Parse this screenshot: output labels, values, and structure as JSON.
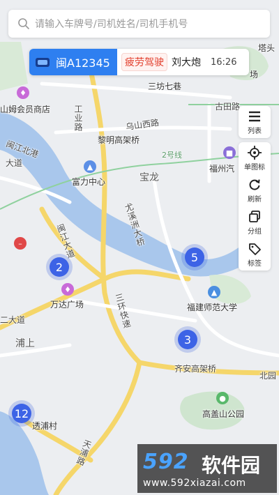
{
  "search": {
    "placeholder": "请输入车牌号/司机姓名/司机手机号"
  },
  "vehicle_card": {
    "plate": "闽A12345",
    "status": "疲劳驾驶",
    "driver": "刘大炮",
    "time": "16:26"
  },
  "toolbar_top": [
    {
      "label": "列表",
      "icon": "list-icon"
    }
  ],
  "toolbar_main": [
    {
      "label": "单图标",
      "icon": "crosshair-icon"
    },
    {
      "label": "刷新",
      "icon": "refresh-icon"
    },
    {
      "label": "分组",
      "icon": "group-icon"
    },
    {
      "label": "标签",
      "icon": "tag-icon"
    }
  ],
  "clusters": [
    {
      "count": "2"
    },
    {
      "count": "5"
    },
    {
      "count": "3"
    },
    {
      "count": "12"
    }
  ],
  "map_labels": {
    "tashan": "塔头",
    "sanfang": "三坊七巷",
    "gutian": "古田路",
    "wushan": "乌山西路",
    "gongye": "工业路",
    "liming": "黎明高架桥",
    "line2": "2号线",
    "fuzhou": "福州汽",
    "minjiang_north": "闽江北港",
    "fuli": "富力中心",
    "baolong": "宝龙",
    "dadao": "大道",
    "youxi": "尤溪洲大桥",
    "minjiang_dadao": "闽江大道",
    "wanda": "万达广场",
    "normal_univ": "福建师范大学",
    "sanhuan": "三环快速",
    "erda": "二大道",
    "pushang": "浦上",
    "qian": "齐安高架桥",
    "beiwei": "北园",
    "gaogai": "高盖山公园",
    "toupu": "透浦村",
    "tianpu": "天浦路",
    "member_store": "山姆会员商店",
    "shop": "场"
  },
  "watermark": {
    "logo": "592",
    "name": "软件园",
    "url": "www.592xiazai.com"
  }
}
